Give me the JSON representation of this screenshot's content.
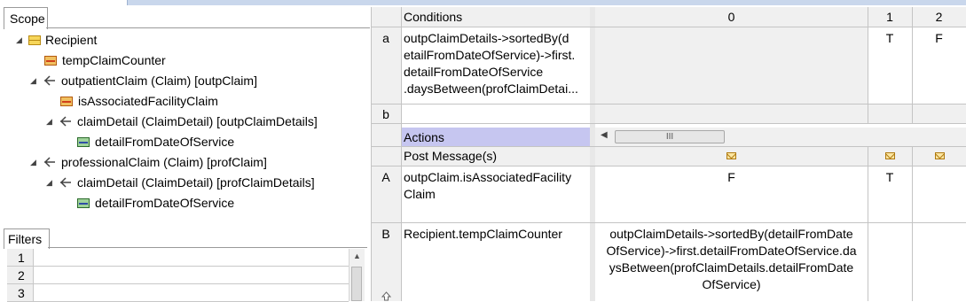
{
  "scope_panel": {
    "tab_label": "Scope",
    "tree": [
      {
        "label": "Recipient"
      },
      {
        "label": "tempClaimCounter"
      },
      {
        "label": "outpatientClaim (Claim) [outpClaim]"
      },
      {
        "label": "isAssociatedFacilityClaim"
      },
      {
        "label": "claimDetail (ClaimDetail) [outpClaimDetails]"
      },
      {
        "label": "detailFromDateOfService"
      },
      {
        "label": "professionalClaim (Claim) [profClaim]"
      },
      {
        "label": "claimDetail (ClaimDetail) [profClaimDetails]"
      },
      {
        "label": "detailFromDateOfService"
      }
    ]
  },
  "filters_panel": {
    "tab_label": "Filters",
    "rows": [
      "1",
      "2",
      "3"
    ]
  },
  "table": {
    "conditions_header": "Conditions",
    "column_headers": [
      "0",
      "1",
      "2"
    ],
    "conditions": [
      {
        "id": "a",
        "lines": [
          "outpClaimDetails->sortedBy(d",
          "etailFromDateOfService)->first.",
          "detailFromDateOfService",
          ".daysBetween(profClaimDetai..."
        ],
        "values": [
          "",
          "T",
          "F"
        ]
      },
      {
        "id": "b",
        "lines": [
          ""
        ],
        "values": [
          "",
          "",
          ""
        ]
      }
    ],
    "actions_header": "Actions",
    "post_message_label": "Post Message(s)",
    "actions": [
      {
        "id": "A",
        "lines": [
          "outpClaim.isAssociatedFacility",
          "Claim"
        ],
        "values": [
          "F",
          "T",
          ""
        ]
      },
      {
        "id": "B",
        "lines": [
          "Recipient.tempClaimCounter"
        ],
        "col0_lines": [
          "outpClaimDetails->sortedBy(detailFromDate",
          "OfService)->first.detailFromDateOfService.da",
          "ysBetween(profClaimDetails.detailFromDate",
          "OfService)"
        ],
        "values": [
          "",
          ""
        ]
      }
    ]
  },
  "hscroll": {
    "thumb_glyph": "III",
    "left_arrow": "◀"
  }
}
